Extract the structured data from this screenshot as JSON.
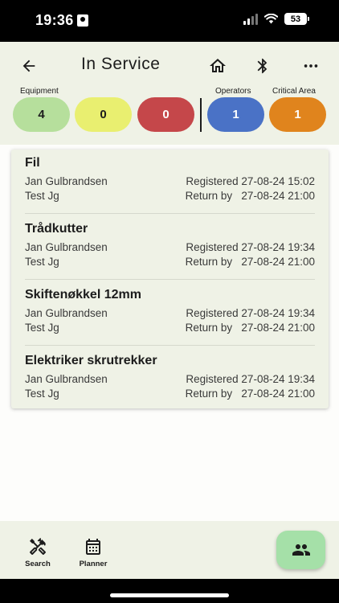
{
  "status_bar": {
    "time": "19:36",
    "battery": "53"
  },
  "header": {
    "title": "In Service",
    "labels": {
      "equipment": "Equipment",
      "operators": "Operators",
      "critical_area": "Critical Area"
    },
    "counts": {
      "green": "4",
      "yellow": "0",
      "red": "0",
      "operators": "1",
      "critical_area": "1"
    }
  },
  "items": [
    {
      "name": "Fil",
      "person": "Jan Gulbrandsen",
      "registered": "Registered 27-08-24 15:02",
      "location": "Test Jg",
      "return_by": "Return by   27-08-24 21:00"
    },
    {
      "name": "Trådkutter",
      "person": "Jan Gulbrandsen",
      "registered": "Registered 27-08-24 19:34",
      "location": "Test Jg",
      "return_by": "Return by   27-08-24 21:00"
    },
    {
      "name": "Skiftenøkkel 12mm",
      "person": "Jan Gulbrandsen",
      "registered": "Registered 27-08-24 19:34",
      "location": "Test Jg",
      "return_by": "Return by   27-08-24 21:00"
    },
    {
      "name": "Elektriker skrutrekker",
      "person": "Jan Gulbrandsen",
      "registered": "Registered 27-08-24 19:34",
      "location": "Test Jg",
      "return_by": "Return by   27-08-24 21:00"
    }
  ],
  "bottom_nav": {
    "search": "Search",
    "planner": "Planner"
  },
  "colors": {
    "green": "#b6df9c",
    "yellow": "#e9ef70",
    "red": "#c5474a",
    "blue": "#4a72c6",
    "orange": "#e0841d",
    "fab": "#a5e0a8"
  },
  "icons": [
    "arrow-back-icon",
    "home-icon",
    "bluetooth-icon",
    "more-horizontal-icon",
    "tools-icon",
    "calendar-icon",
    "people-icon"
  ]
}
